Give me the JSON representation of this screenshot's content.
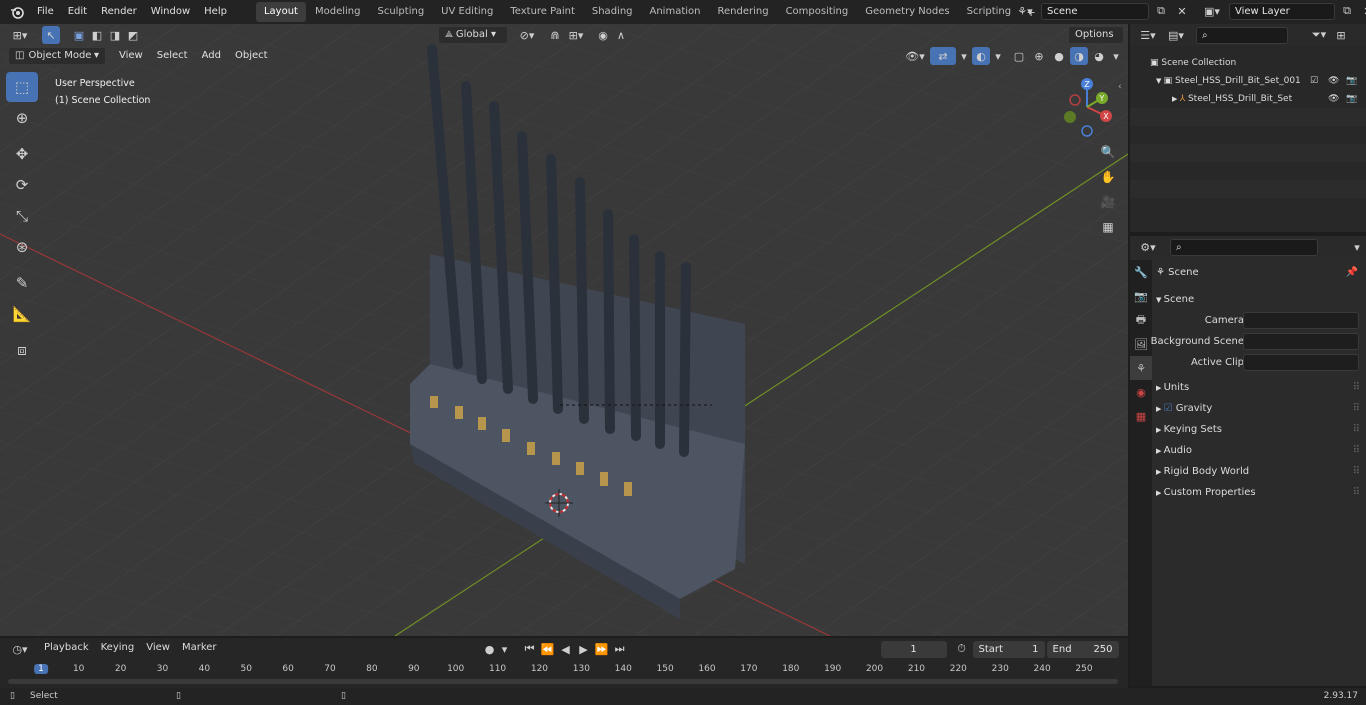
{
  "menu": [
    "File",
    "Edit",
    "Render",
    "Window",
    "Help"
  ],
  "workspaces": [
    "Layout",
    "Modeling",
    "Sculpting",
    "UV Editing",
    "Texture Paint",
    "Shading",
    "Animation",
    "Rendering",
    "Compositing",
    "Geometry Nodes",
    "Scripting"
  ],
  "active_workspace": "Layout",
  "scene_name": "Scene",
  "view_layer": "View Layer",
  "viewport": {
    "orientation": "Global",
    "options_label": "Options",
    "mode": "Object Mode",
    "menus": [
      "View",
      "Select",
      "Add",
      "Object"
    ],
    "info_line1": "User Perspective",
    "info_line2": "(1) Scene Collection",
    "gizmo": {
      "x": "X",
      "y": "Y",
      "z": "Z"
    }
  },
  "outliner": {
    "root": "Scene Collection",
    "items": [
      {
        "label": "Steel_HSS_Drill_Bit_Set_001",
        "level": 1
      },
      {
        "label": "Steel_HSS_Drill_Bit_Set",
        "level": 2
      }
    ]
  },
  "properties": {
    "header": "Scene",
    "section": "Scene",
    "fields": [
      {
        "label": "Camera",
        "value": ""
      },
      {
        "label": "Background Scene",
        "value": ""
      },
      {
        "label": "Active Clip",
        "value": ""
      }
    ],
    "panels": [
      "Units",
      "Gravity",
      "Keying Sets",
      "Audio",
      "Rigid Body World",
      "Custom Properties"
    ],
    "gravity_checked": true
  },
  "timeline": {
    "menus": [
      "Playback",
      "Keying",
      "View",
      "Marker"
    ],
    "current_frame": "1",
    "start_label": "Start",
    "start": "1",
    "end_label": "End",
    "end": "250",
    "ticks": [
      "1",
      "10",
      "20",
      "30",
      "40",
      "50",
      "60",
      "70",
      "80",
      "90",
      "100",
      "110",
      "120",
      "130",
      "140",
      "150",
      "160",
      "170",
      "180",
      "190",
      "200",
      "210",
      "220",
      "230",
      "240",
      "250"
    ]
  },
  "status": {
    "left": "Select",
    "version": "2.93.17"
  },
  "colors": {
    "accent": "#4772b3",
    "x_axis": "#c04040",
    "y_axis": "#7a9a2a",
    "viewport_bg": "#393939",
    "model": "#4b5563"
  }
}
